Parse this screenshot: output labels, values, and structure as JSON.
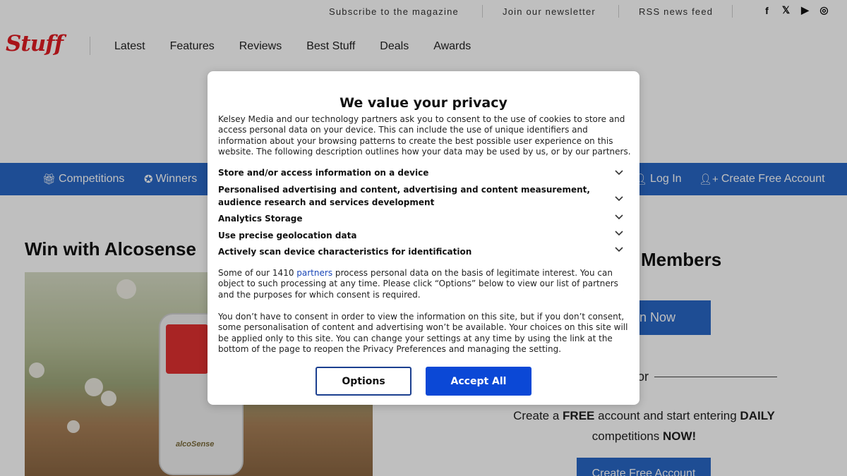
{
  "topbar": {
    "links": [
      "Subscribe to the magazine",
      "Join our newsletter",
      "RSS news feed"
    ],
    "social_icons": [
      "facebook-icon",
      "x-icon",
      "youtube-icon",
      "instagram-icon"
    ],
    "social_glyphs": [
      "f",
      "𝕏",
      "▶",
      "◎"
    ]
  },
  "header": {
    "logo": "Stuff",
    "nav": [
      "Latest",
      "Features",
      "Reviews",
      "Best Stuff",
      "Deals",
      "Awards"
    ]
  },
  "subnav": {
    "competitions": "Competitions",
    "winners": "Winners",
    "login": "Log In",
    "create_account": "Create Free Account"
  },
  "page": {
    "title": "Win with Alcosense",
    "members_heading": "Members",
    "join_button": "n Now",
    "or": "or",
    "promo_pre": "Create a ",
    "promo_free": "FREE",
    "promo_mid": " account and start entering ",
    "promo_daily": "DAILY",
    "promo_post": " competitions ",
    "promo_now": "NOW!",
    "create_button": "Create Free Account",
    "device_brand": "alcoSense"
  },
  "modal": {
    "title": "We value your privacy",
    "intro": "Kelsey Media and our technology partners ask you to consent to the use of cookies to store and access personal data on your device. This can include the use of unique identifiers and information about your browsing patterns to create the best possible user experience on this website. The following description outlines how your data may be used by us, or by our partners.",
    "purposes": [
      "Store and/or access information on a device",
      "Personalised advertising and content, advertising and content measurement, audience research and services development",
      "Analytics Storage",
      "Use precise geolocation data",
      "Actively scan device characteristics for identification"
    ],
    "legit_pre": "Some of our 1410 ",
    "legit_link": "partners",
    "legit_post": " process personal data on the basis of legitimate interest. You can object to such processing at any time. Please click “Options” below to view our list of partners and the purposes for which consent is required.",
    "consent_text": "You don’t have to consent in order to view the information on this site, but if you don’t consent, some personalisation of content and advertising won’t be available. Your choices on this site will be applied only to this site. You can change your settings at any time by using the link at the bottom of the page to reopen the Privacy Preferences and managing the setting.",
    "options_button": "Options",
    "accept_button": "Accept All"
  },
  "colors": {
    "brand_red": "#e01b22",
    "nav_blue": "#2867c6",
    "accept_blue": "#0b48d6",
    "link_blue": "#1a47b8"
  }
}
